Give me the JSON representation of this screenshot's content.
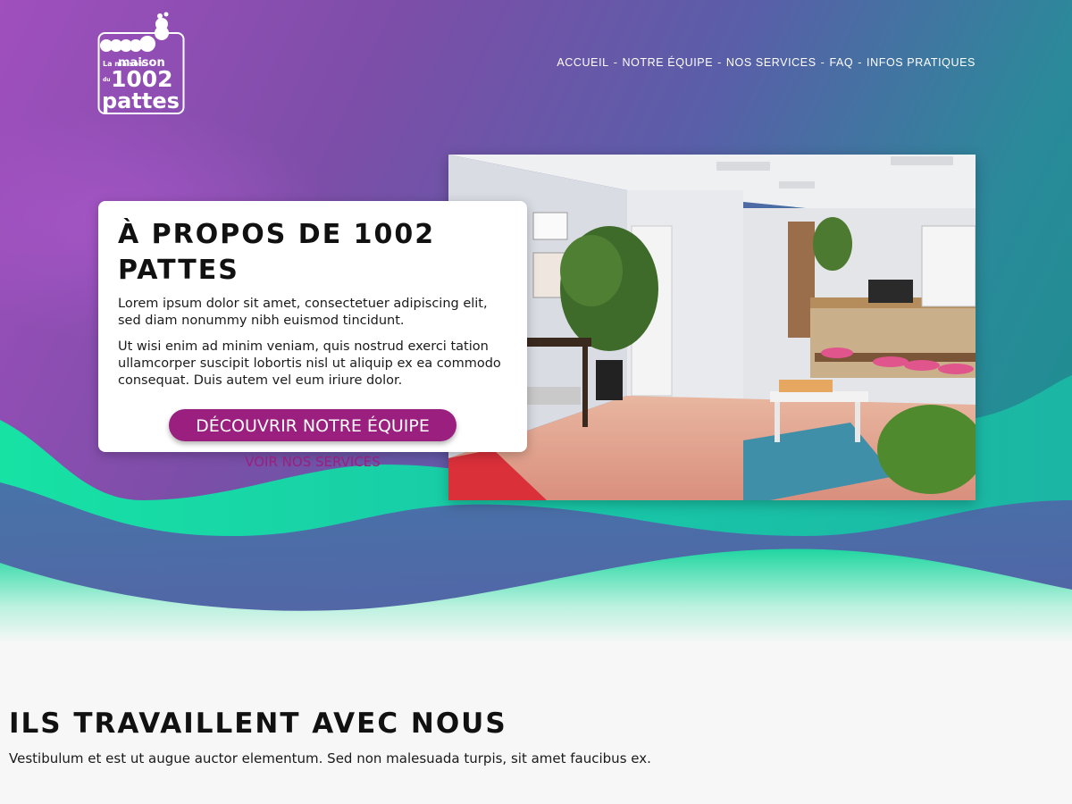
{
  "logo": {
    "line1": "La maison",
    "line2_small": "du",
    "line2": "1002",
    "line3": "pattes"
  },
  "nav": {
    "items": [
      "ACCUEIL",
      "NOTRE ÉQUIPE",
      "NOS SERVICES",
      "FAQ",
      "INFOS PRATIQUES"
    ],
    "separator": "-"
  },
  "hero": {
    "title": "À PROPOS DE 1002 PATTES",
    "paragraph1": "Lorem ipsum dolor sit amet, consectetuer adipiscing elit, sed diam nonummy nibh euismod tincidunt.",
    "paragraph2": "Ut wisi enim ad minim veniam, quis nostrud exerci tation ullamcorper suscipit lobortis nisl ut aliquip ex ea commodo consequat. Duis autem vel eum iriure dolor.",
    "primary_button": "DÉCOUVRIR NOTRE ÉQUIPE",
    "secondary_link": "VOIR NOS SERVICES"
  },
  "partners": {
    "title": "ILS TRAVAILLENT AVEC NOUS",
    "text": "Vestibulum et est ut augue auctor elementum. Sed non malesuada turpis, sit amet faucibus ex."
  },
  "colors": {
    "brand_purple": "#9a1f7e",
    "hero_purple": "#a04fbd",
    "hero_teal": "#1a8f8c",
    "wave_green": "#19e0a0",
    "page_bg": "#f7f7f7"
  }
}
